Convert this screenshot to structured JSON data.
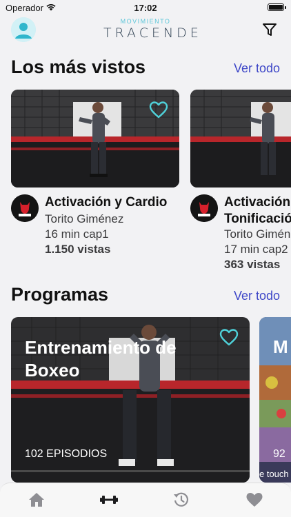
{
  "status_bar": {
    "carrier": "Operador",
    "time": "17:02"
  },
  "header": {
    "logo_top": "MOVIMIENTO",
    "logo_main": "TRACENDE"
  },
  "most_viewed": {
    "title": "Los más vistos",
    "see_all": "Ver todo",
    "items": [
      {
        "title": "Activación y Cardio",
        "author": "Torito Giménez",
        "duration": "16 min cap1",
        "views": "1.150 vistas"
      },
      {
        "title": "Activación y Tonificación",
        "title_line1": "Activación",
        "title_line2": "Tonificación",
        "author": "Torito Giménez",
        "duration": "17 min cap2",
        "views": "363 vistas"
      }
    ]
  },
  "programs": {
    "title": "Programas",
    "see_all": "Ver todo",
    "items": [
      {
        "title": "Entrenamiento de Boxeo",
        "episodes": "102 EPISODIOS"
      },
      {
        "title": "M",
        "episodes": "92",
        "overlay_text": "e touch"
      }
    ]
  },
  "tabbar": {
    "tabs": [
      "home",
      "workouts",
      "history",
      "favorites"
    ],
    "active": "workouts"
  },
  "colors": {
    "accent": "#3d46c7",
    "heart": "#4fd1d9",
    "brand_teal": "#5bc6d9"
  }
}
